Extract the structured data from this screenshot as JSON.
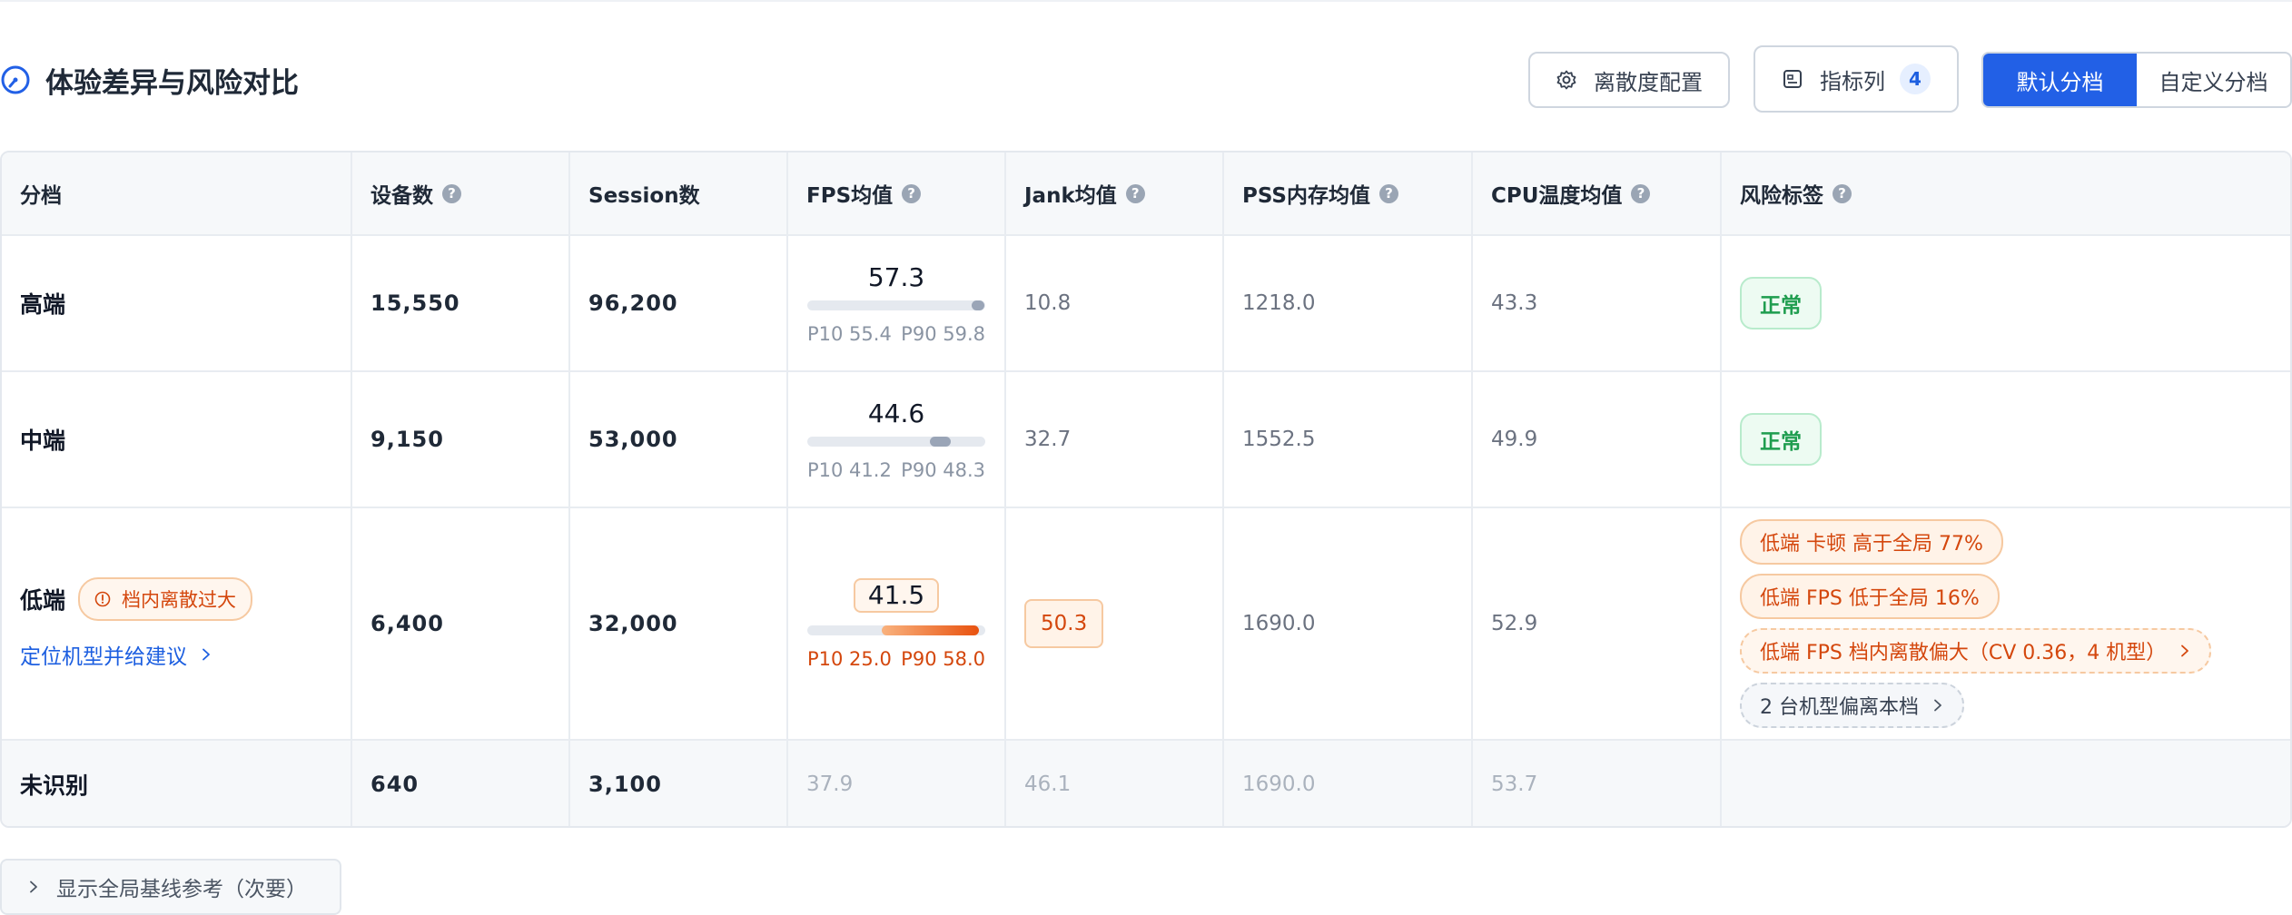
{
  "header": {
    "title": "体验差异与风险对比",
    "title_icon": "gauge-icon",
    "dispersion_btn": "离散度配置",
    "metric_btn": "指标列",
    "metric_count": "4",
    "seg_default": "默认分档",
    "seg_custom": "自定义分档"
  },
  "columns": [
    "分档",
    "设备数",
    "Session数",
    "FPS均值",
    "Jank均值",
    "PSS内存均值",
    "CPU温度均值",
    "风险标签"
  ],
  "help_icon": "?",
  "rows": [
    {
      "tier": "高端",
      "devices": "15,550",
      "sessions": "96,200",
      "fps": {
        "avg": "57.3",
        "p10": "P10 55.4",
        "p90": "P90 59.8",
        "p10_value": 55.4,
        "p90_value": 59.8
      },
      "jank": "10.8",
      "pss": "1218.0",
      "cpu": "43.3",
      "risk": "正常"
    },
    {
      "tier": "中端",
      "devices": "9,150",
      "sessions": "53,000",
      "fps": {
        "avg": "44.6",
        "p10": "P10 41.2",
        "p90": "P90 48.3",
        "p10_value": 41.2,
        "p90_value": 48.3
      },
      "jank": "32.7",
      "pss": "1552.5",
      "cpu": "49.9",
      "risk": "正常"
    },
    {
      "tier": "低端",
      "warning": "档内离散过大",
      "link": "定位机型并给建议",
      "devices": "6,400",
      "sessions": "32,000",
      "fps": {
        "avg": "41.5",
        "p10": "P10 25.0",
        "p90": "P90 58.0",
        "p10_value": 25.0,
        "p90_value": 58.0
      },
      "jank": "50.3",
      "pss": "1690.0",
      "cpu": "52.9",
      "risks": [
        "低端 卡顿 高于全局 77%",
        "低端 FPS 低于全局 16%",
        "低端 FPS 档内离散偏大（CV 0.36，4 机型）",
        "2 台机型偏离本档"
      ]
    },
    {
      "tier": "未识别",
      "devices": "640",
      "sessions": "3,100",
      "fps_avg": "37.9",
      "jank": "46.1",
      "pss": "1690.0",
      "cpu": "53.7"
    }
  ],
  "fps_scale": [
    0,
    60
  ],
  "baseline_toggle": "显示全局基线参考（次要）",
  "colors": {
    "primary": "#2260e6",
    "warning": "#d4470d",
    "success": "#1f9d4f"
  }
}
